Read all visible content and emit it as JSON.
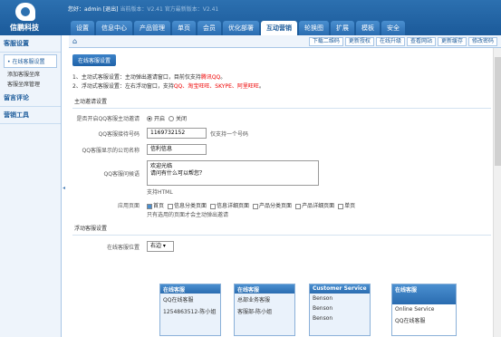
{
  "brand": {
    "name": "信鹏科技"
  },
  "header": {
    "greeting": "您好：admin",
    "logout": "[退出]",
    "version_cur": "当前版本：V2.41",
    "version_latest": "官方最新版本：V2.41"
  },
  "nav": {
    "tabs": [
      "设置",
      "信息中心",
      "产品管理",
      "单页",
      "会员",
      "优化部署",
      "互动营销",
      "轮换图",
      "扩展",
      "模板",
      "安全"
    ],
    "active": "互动营销"
  },
  "sidebar": {
    "sections": [
      {
        "title": "客服设置",
        "items": [
          {
            "label": "• 在线客服设置",
            "active": true
          },
          {
            "label": "添加客服坐席",
            "active": false
          },
          {
            "label": "客服坐席管理",
            "active": false
          }
        ]
      },
      {
        "title": "留言评论",
        "items": []
      },
      {
        "title": "营销工具",
        "items": []
      }
    ]
  },
  "toolbar": {
    "buttons": [
      "下载二维码",
      "更新授权",
      "在线升级",
      "查看网站",
      "更新缓存",
      "修改密码"
    ]
  },
  "page": {
    "title": "在线客服设置",
    "note1_prefix": "1、主动式客服设置：主动弹出邀请窗口，目前仅支持",
    "note1_red": "腾讯QQ",
    "note1_suffix": "。",
    "note2_prefix": "2、浮动式客服设置：左右浮动窗口，支持",
    "note2_red": "QQ、淘宝旺旺、SKYPE、阿里旺旺",
    "note2_suffix": "。",
    "section_active": "主动邀请设置",
    "enable_label": "是否开启QQ客服主动邀请",
    "enable_on": "开启",
    "enable_off": "关闭",
    "qq_label": "QQ客服接待号码",
    "qq_value": "1169732152",
    "qq_hint": "仅支持一个号码",
    "company_label": "QQ客服显示的公司名称",
    "company_value": "信利信息",
    "greet_label": "QQ客服问候语",
    "greet_line1": "欢迎光临",
    "greet_line2": "请问有什么可以帮您？",
    "greet_hint": "支持HTML",
    "pages_label": "应用页面",
    "pages_opts": [
      {
        "label": "首页",
        "checked": true
      },
      {
        "label": "信息分类页面",
        "checked": false
      },
      {
        "label": "信息详细页面",
        "checked": false
      },
      {
        "label": "产品分类页面",
        "checked": false
      },
      {
        "label": "产品详细页面",
        "checked": false
      },
      {
        "label": "单页",
        "checked": false
      }
    ],
    "pages_hint": "只有选用的页面才会主动弹出邀请",
    "section_float": "浮动客服设置",
    "pos_label": "在线客服位置",
    "pos_value": "右边",
    "templates": [
      {
        "title": "在线客服",
        "items": [
          "QQ在线客服",
          "1254863512-陈小姐"
        ]
      },
      {
        "title": "在线客服",
        "items": [
          "总部业务客服",
          "客服部-陈小姐"
        ]
      },
      {
        "title": "Customer Service",
        "items": [
          "Benson",
          "Benson",
          "Benson"
        ]
      },
      {
        "title": "在线客服",
        "items": [
          "Online Service",
          "QQ在线客服"
        ]
      }
    ]
  }
}
